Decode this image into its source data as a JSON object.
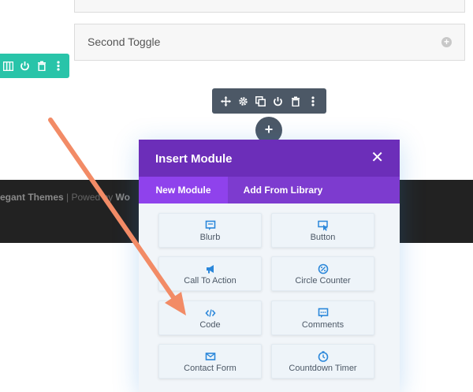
{
  "toggle": {
    "title": "Second Toggle",
    "icon": "plus-circle-icon"
  },
  "row_toolbar": {
    "icons": [
      "columns-icon",
      "power-icon",
      "trash-icon",
      "more-icon"
    ],
    "color": "#29c4a9"
  },
  "module_toolbar": {
    "icons": [
      "move-icon",
      "settings-icon",
      "duplicate-icon",
      "power-icon",
      "trash-icon",
      "more-icon"
    ],
    "color": "#4c5866"
  },
  "add_button": {
    "label": "+"
  },
  "footer": {
    "text_start": "egant Themes",
    "separator": " | Powe",
    "text_mid": "d by ",
    "text_end": "Wo"
  },
  "modal": {
    "title": "Insert Module",
    "close": "✕",
    "tabs": [
      {
        "label": "New Module",
        "active": true
      },
      {
        "label": "Add From Library",
        "active": false
      }
    ],
    "modules": [
      {
        "label": "Blurb",
        "icon": "blurb-icon"
      },
      {
        "label": "Button",
        "icon": "cursor-icon"
      },
      {
        "label": "Call To Action",
        "icon": "megaphone-icon"
      },
      {
        "label": "Circle Counter",
        "icon": "circle-counter-icon"
      },
      {
        "label": "Code",
        "icon": "code-icon"
      },
      {
        "label": "Comments",
        "icon": "comment-icon"
      },
      {
        "label": "Contact Form",
        "icon": "envelope-icon"
      },
      {
        "label": "Countdown Timer",
        "icon": "timer-icon"
      }
    ],
    "header_color": "#6c2eb9",
    "tabs_color": "#7d3bcf",
    "icon_color": "#2b87da"
  },
  "annotation": {
    "arrow_color": "#f28b66"
  }
}
